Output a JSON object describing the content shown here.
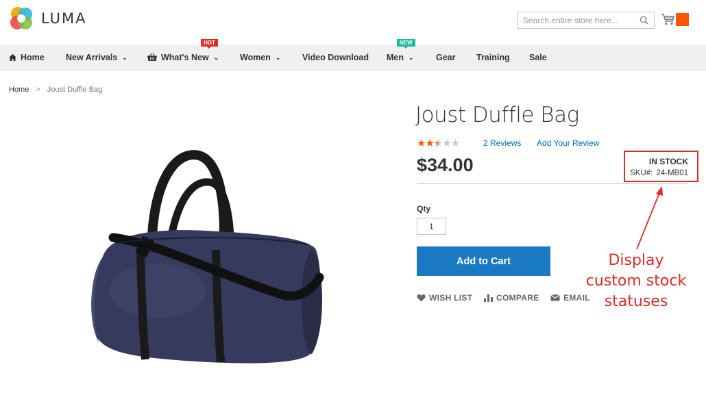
{
  "header": {
    "logo_text": "LUMA",
    "search_placeholder": "Search entire store here...",
    "icons": [
      "search-icon",
      "cart-icon"
    ],
    "cart_badge_color": "#ff5501"
  },
  "nav": {
    "items": [
      {
        "label": "Home",
        "icon": "home-icon"
      },
      {
        "label": "New Arrivals",
        "dropdown": true
      },
      {
        "label": "What's New",
        "icon": "basket-icon",
        "dropdown": true,
        "tag": "HOT"
      },
      {
        "label": "Women",
        "dropdown": true
      },
      {
        "label": "Video Download"
      },
      {
        "label": "Men",
        "dropdown": true,
        "tag": "NEW"
      },
      {
        "label": "Gear"
      },
      {
        "label": "Training"
      },
      {
        "label": "Sale"
      }
    ],
    "chevron": "⌄"
  },
  "breadcrumb": {
    "home": "Home",
    "separator": ">",
    "current": "Joust Duffle Bag"
  },
  "product": {
    "title": "Joust Duffle Bag",
    "rating_stars": 2.5,
    "rating_max": 5,
    "reviews_link": "2 Reviews",
    "add_review_link": "Add Your Review",
    "price": "$34.00",
    "stock_status": "IN STOCK",
    "sku_label": "SKU#:",
    "sku_value": "24-MB01",
    "qty_label": "Qty",
    "qty_value": "1",
    "add_to_cart": "Add to Cart",
    "actions": {
      "wishlist": "WISH LIST",
      "compare": "COMPARE",
      "email": "EMAIL"
    }
  },
  "annotation": {
    "line1": "Display",
    "line2": "custom stock",
    "line3": "statuses",
    "color": "#e02b27"
  },
  "colors": {
    "primary_button": "#1979c3",
    "link": "#006bb4",
    "star_on": "#ff5501",
    "nav_bg": "#f0f0f0"
  }
}
